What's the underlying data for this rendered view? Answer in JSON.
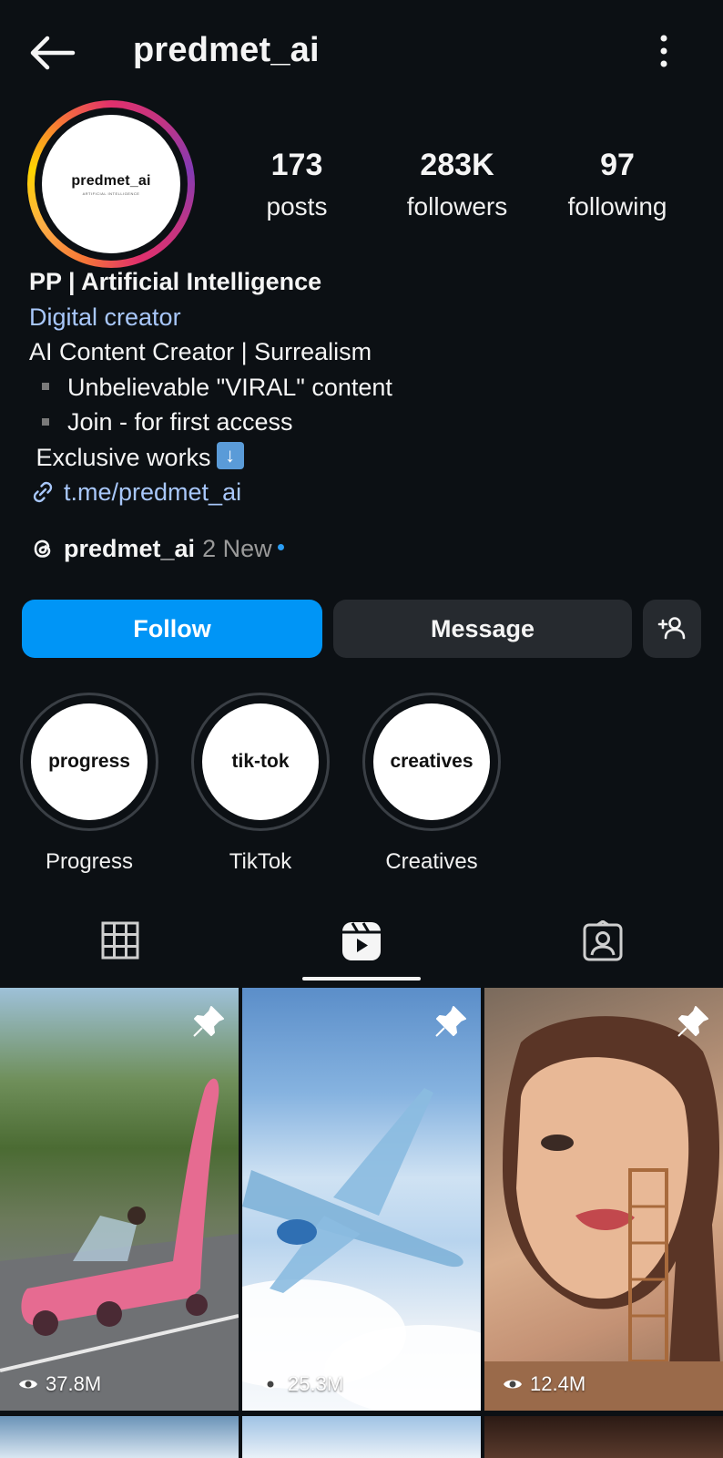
{
  "header": {
    "username": "predmet_ai"
  },
  "profile": {
    "avatar_logo": "predmet_ai",
    "avatar_subtext": "ARTIFICIAL INTELLIGENCE",
    "stats": [
      {
        "value": "173",
        "label": "posts"
      },
      {
        "value": "283K",
        "label": "followers"
      },
      {
        "value": "97",
        "label": "following"
      }
    ]
  },
  "bio": {
    "name": "PP | Artificial Intelligence",
    "category": "Digital creator",
    "lines": [
      "AI Content Creator | Surrealism",
      "Unbelievable \"VIRAL\" content",
      "Join - for first access",
      "Exclusive works"
    ],
    "link": "t.me/predmet_ai"
  },
  "threads": {
    "name": "predmet_ai",
    "new_label": "2 New"
  },
  "actions": {
    "follow": "Follow",
    "message": "Message"
  },
  "highlights": [
    {
      "cover": "progress",
      "label": "Progress"
    },
    {
      "cover": "tik-tok",
      "label": "TikTok"
    },
    {
      "cover": "creatives",
      "label": "Creatives"
    }
  ],
  "tabs": {
    "active": "reels",
    "items": [
      "grid-icon",
      "reels-icon",
      "tagged-icon"
    ]
  },
  "reels": [
    {
      "views": "37.8M",
      "pinned": true
    },
    {
      "views": "25.3M",
      "pinned": true
    },
    {
      "views": "12.4M",
      "pinned": true
    }
  ],
  "colors": {
    "background": "#0c1014",
    "primary_button": "#0095f6",
    "secondary_button": "#262a2f",
    "link": "#a8c7fa"
  }
}
